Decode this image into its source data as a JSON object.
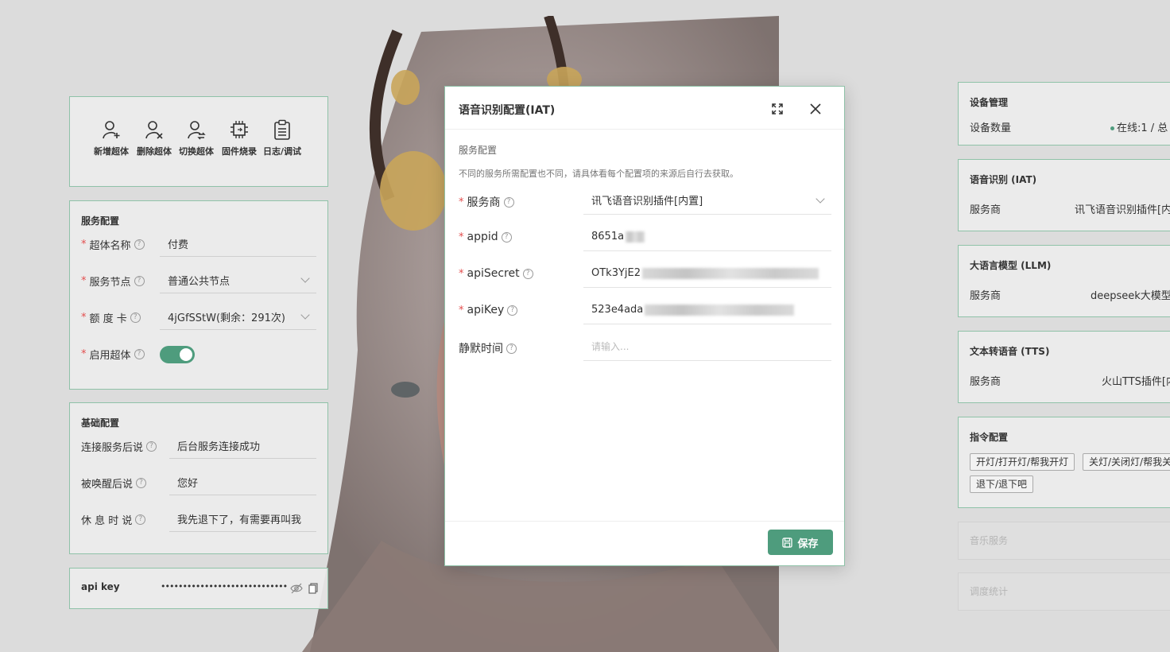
{
  "colors": {
    "accent": "#4e9c7d",
    "border": "#8fc2a8",
    "required": "#e34d4d",
    "muted": "#b5b5b5"
  },
  "toolbar": {
    "items": [
      {
        "icon": "user-add-icon",
        "label": "新增超体"
      },
      {
        "icon": "user-remove-icon",
        "label": "删除超体"
      },
      {
        "icon": "user-switch-icon",
        "label": "切换超体"
      },
      {
        "icon": "chip-icon",
        "label": "固件烧录"
      },
      {
        "icon": "clipboard-icon",
        "label": "日志/调试"
      }
    ]
  },
  "service_config": {
    "title": "服务配置",
    "name_label": "超体名称",
    "name_value": "付费",
    "node_label": "服务节点",
    "node_value": "普通公共节点",
    "card_label": "额 度 卡",
    "card_value": "4jGfSStW(剩余：291次)",
    "enable_label": "启用超体",
    "enabled": true
  },
  "basic_config": {
    "title": "基础配置",
    "connect_label": "连接服务后说",
    "connect_value": "后台服务连接成功",
    "wake_label": "被唤醒后说",
    "wake_value": "您好",
    "rest_label": "休 息 时 说",
    "rest_value": "我先退下了，有需要再叫我"
  },
  "api_key": {
    "label": "api key",
    "value": "••••••••••••••••••••••••••••••"
  },
  "right": {
    "device": {
      "title": "设备管理",
      "key": "设备数量",
      "value": "在线:1 / 总"
    },
    "iat": {
      "title": "语音识别 (IAT)",
      "key": "服务商",
      "value": "讯飞语音识别插件[内"
    },
    "llm": {
      "title": "大语言模型 (LLM)",
      "key": "服务商",
      "value": "deepseek大模型"
    },
    "tts": {
      "title": "文本转语音 (TTS)",
      "key": "服务商",
      "value": "火山TTS插件[内"
    },
    "cmd": {
      "title": "指令配置",
      "tags": [
        "开灯/打开灯/帮我开灯",
        "关灯/关闭灯/帮我关",
        "退下/退下吧"
      ]
    },
    "music": {
      "title": "音乐服务"
    },
    "schedule": {
      "title": "调度统计"
    }
  },
  "modal": {
    "title": "语音识别配置(IAT)",
    "section": "服务配置",
    "hint": "不同的服务所需配置也不同，请具体看每个配置项的来源后自行去获取。",
    "provider_label": "服务商",
    "provider_value": "讯飞语音识别插件[内置]",
    "appid_label": "appid",
    "appid_value": "8651a",
    "secret_label": "apiSecret",
    "secret_value": "OTk3YjE2",
    "key_label": "apiKey",
    "key_value": "523e4ada",
    "silence_label": "静默时间",
    "silence_placeholder": "请输入...",
    "save_label": "保存"
  }
}
